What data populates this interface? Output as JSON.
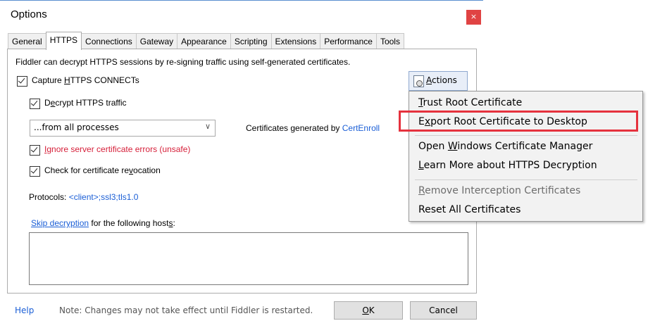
{
  "window": {
    "title": "Options",
    "close_symbol": "×"
  },
  "tabs": [
    "General",
    "HTTPS",
    "Connections",
    "Gateway",
    "Appearance",
    "Scripting",
    "Extensions",
    "Performance",
    "Tools"
  ],
  "active_tab": "HTTPS",
  "https": {
    "description": "Fiddler can decrypt HTTPS sessions by re-signing traffic using self-generated certificates.",
    "capture_label_pre": "Capture ",
    "capture_label_u": "H",
    "capture_label_post": "TTPS CONNECTs",
    "decrypt_label_pre": "D",
    "decrypt_label_u": "e",
    "decrypt_label_post": "crypt HTTPS traffic",
    "process_filter_value": "...from all processes",
    "process_filter_arrow": "∨",
    "certs_generated_label": "Certificates generated by ",
    "certs_generator_link": "CertEnroll",
    "ignore_errors_u": "I",
    "ignore_errors_post": "gnore server certificate errors (unsafe)",
    "revocation_pre": "Check for certificate re",
    "revocation_u": "v",
    "revocation_post": "ocation",
    "protocols_label": "Protocols: ",
    "protocols_value": "<client>;ssl3;tls1.0",
    "skip_link": "Skip decryption",
    "skip_suffix_pre": " for the following host",
    "skip_suffix_u": "s",
    "skip_suffix_post": ":",
    "hosts_value": "",
    "actions_u": "A",
    "actions_post": "ctions"
  },
  "actions_menu": {
    "items": [
      {
        "u": "T",
        "post": "rust Root Certificate",
        "enabled": true
      },
      {
        "pre": "E",
        "u": "x",
        "post": "port Root Certificate to Desktop",
        "enabled": true
      },
      {
        "pre": "Open ",
        "u": "W",
        "post": "indows Certificate Manager",
        "enabled": true
      },
      {
        "u": "L",
        "post": "earn More about HTTPS Decryption",
        "enabled": true
      },
      {
        "u": "R",
        "post": "emove Interception Certificates",
        "enabled": false
      },
      {
        "post": "Reset All Certificates",
        "enabled": true
      }
    ]
  },
  "footer": {
    "help": "Help",
    "note": "Note: Changes may not take effect until Fiddler is restarted.",
    "ok_u": "O",
    "ok_post": "K",
    "cancel": "Cancel"
  },
  "colors": {
    "link": "#1a5ed6",
    "warning_red": "#d6203a",
    "highlight_box": "#e5323e",
    "close_button": "#e04343"
  }
}
